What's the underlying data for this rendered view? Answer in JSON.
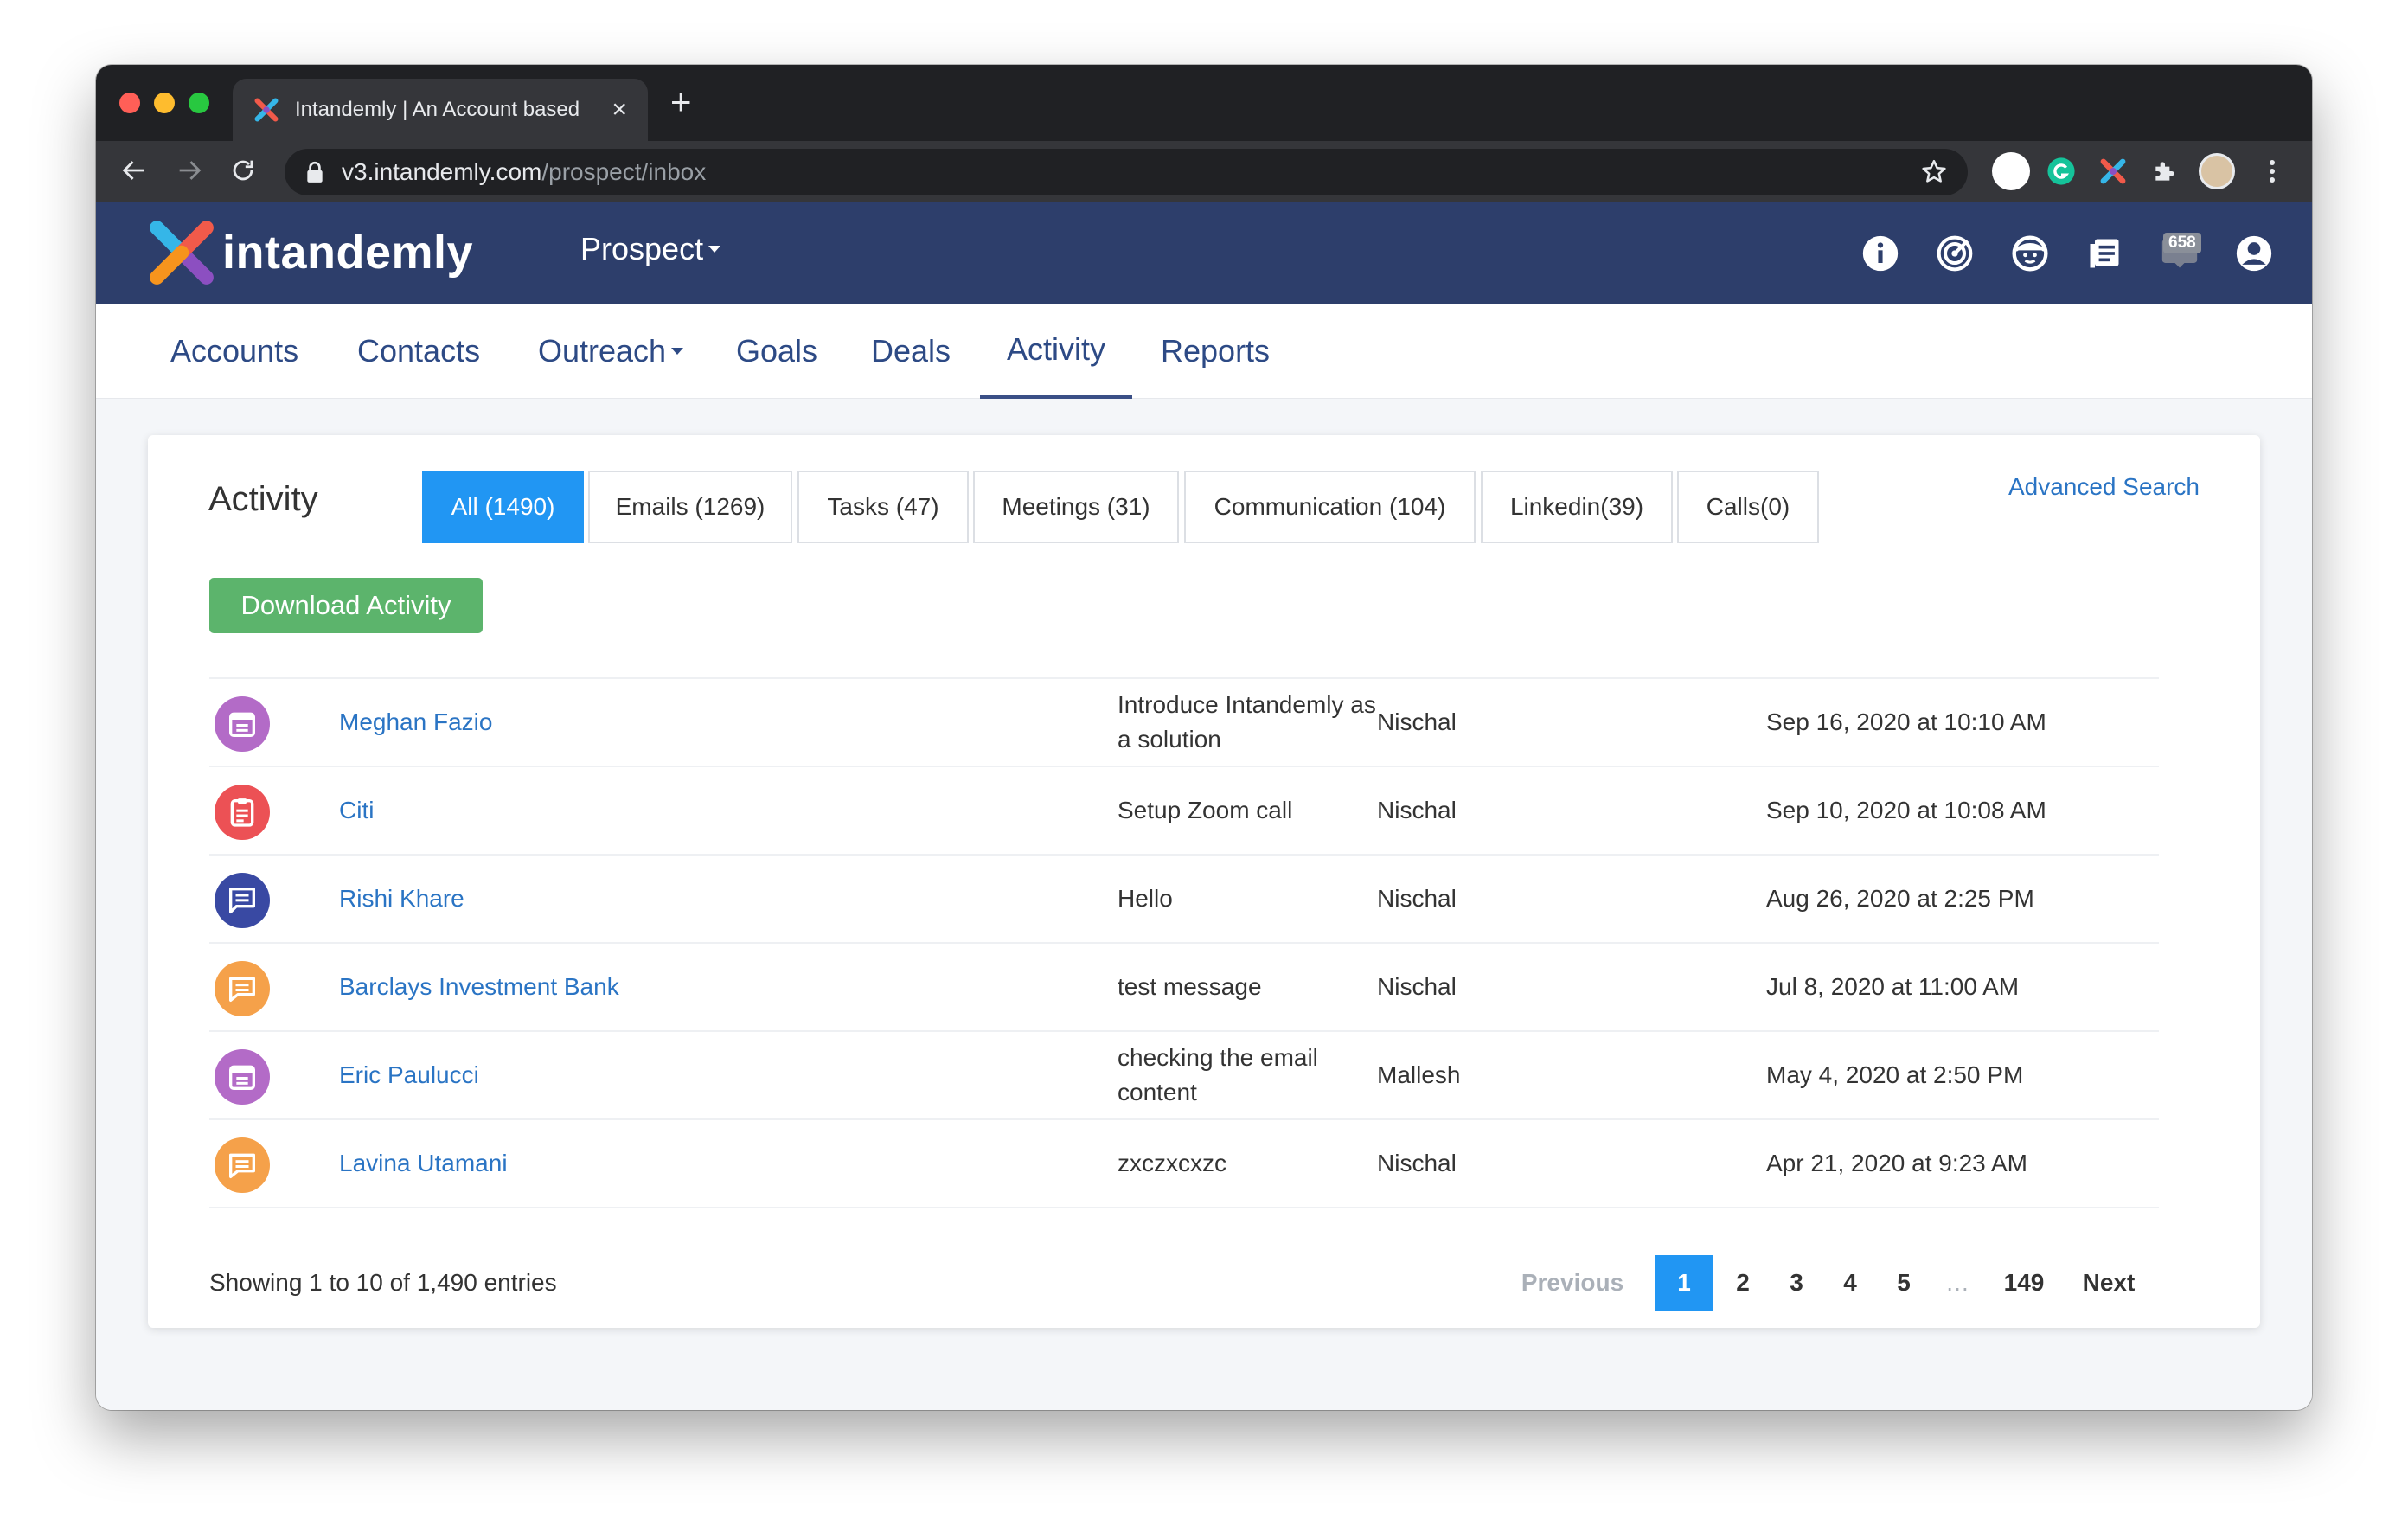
{
  "browser": {
    "tab_title": "Intandemly | An Account based",
    "url_host": "v3.intandemly.com",
    "url_path": "/prospect/inbox"
  },
  "header": {
    "logo_text": "intandemly",
    "module": "Prospect",
    "notification_count": "658",
    "colors": {
      "header_bg": "#2d3e6b",
      "link": "#2a74c4",
      "primary": "#2196f3",
      "success": "#5cb46c"
    }
  },
  "nav": {
    "items": [
      {
        "label": "Accounts"
      },
      {
        "label": "Contacts"
      },
      {
        "label": "Outreach"
      },
      {
        "label": "Goals"
      },
      {
        "label": "Deals"
      },
      {
        "label": "Activity",
        "active": true
      },
      {
        "label": "Reports"
      }
    ]
  },
  "activity": {
    "title": "Activity",
    "filters": [
      {
        "label": "All (1490)",
        "active": true
      },
      {
        "label": "Emails (1269)"
      },
      {
        "label": "Tasks (47)"
      },
      {
        "label": "Meetings (31)"
      },
      {
        "label": "Communication (104)"
      },
      {
        "label": "Linkedin(39)"
      },
      {
        "label": "Calls(0)"
      }
    ],
    "advanced_search": "Advanced Search",
    "download_label": "Download Activity",
    "rows": [
      {
        "icon": "calendar-icon",
        "color": "#b36bc7",
        "name": "Meghan Fazio",
        "subject": "Introduce Intandemly as a solution",
        "owner": "Nischal",
        "date": "Sep 16, 2020 at 10:10 AM"
      },
      {
        "icon": "clipboard-icon",
        "color": "#ec5155",
        "name": "Citi",
        "subject": "Setup Zoom call",
        "owner": "Nischal",
        "date": "Sep 10, 2020 at 10:08 AM"
      },
      {
        "icon": "chat-icon",
        "color": "#3949a3",
        "name": "Rishi Khare",
        "subject": "Hello",
        "owner": "Nischal",
        "date": "Aug 26, 2020 at 2:25 PM"
      },
      {
        "icon": "message-icon",
        "color": "#f5a14a",
        "name": "Barclays Investment Bank",
        "subject": "test message",
        "owner": "Nischal",
        "date": "Jul 8, 2020 at 11:00 AM"
      },
      {
        "icon": "calendar-icon",
        "color": "#b36bc7",
        "name": "Eric Paulucci",
        "subject": "checking the email content",
        "owner": "Mallesh",
        "date": "May 4, 2020 at 2:50 PM"
      },
      {
        "icon": "message-icon",
        "color": "#f5a14a",
        "name": "Lavina Utamani",
        "subject": "zxczxcxzc",
        "owner": "Nischal",
        "date": "Apr 21, 2020 at 9:23 AM"
      }
    ],
    "entries_text": "Showing 1 to 10 of 1,490 entries",
    "pagination": {
      "previous": "Previous",
      "pages": [
        "1",
        "2",
        "3",
        "4",
        "5",
        "…",
        "149"
      ],
      "current": "1",
      "next": "Next"
    }
  }
}
